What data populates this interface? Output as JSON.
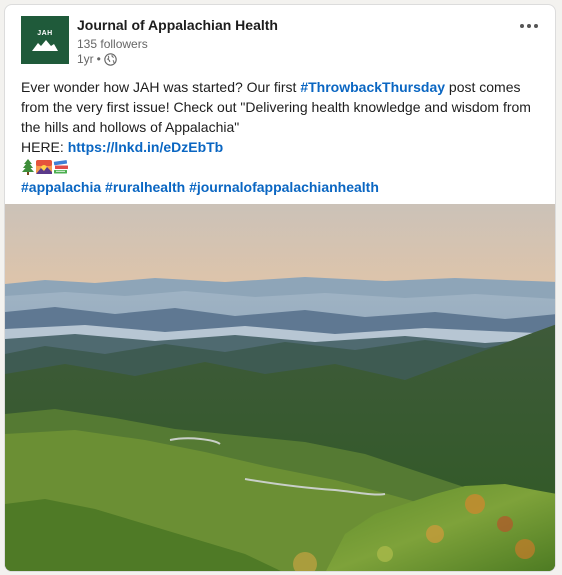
{
  "post": {
    "org_name": "Journal of Appalachian Health",
    "followers": "135 followers",
    "time": "1yr",
    "separator": "•",
    "logo_text": "JAH",
    "text": {
      "part1": "Ever wonder how JAH was started? Our first ",
      "hashtag_throwback": "#ThrowbackThursday",
      "part2": " post comes from the very first issue! Check out \"Delivering health knowledge and wisdom from the hills and hollows of Appalachia\"",
      "here_label": "HERE: ",
      "link": "https://lnkd.in/eDzEbTb",
      "hashtags": [
        "#appalachia",
        "#ruralhealth",
        "#journalofappalachianhealth"
      ]
    },
    "emojis": [
      "evergreen-tree",
      "sunrise-over-mountains",
      "books"
    ],
    "icons": [
      "globe-icon",
      "more-options-icon"
    ]
  },
  "colors": {
    "link": "#0a66c2",
    "logo_bg": "#1f5a3a"
  }
}
